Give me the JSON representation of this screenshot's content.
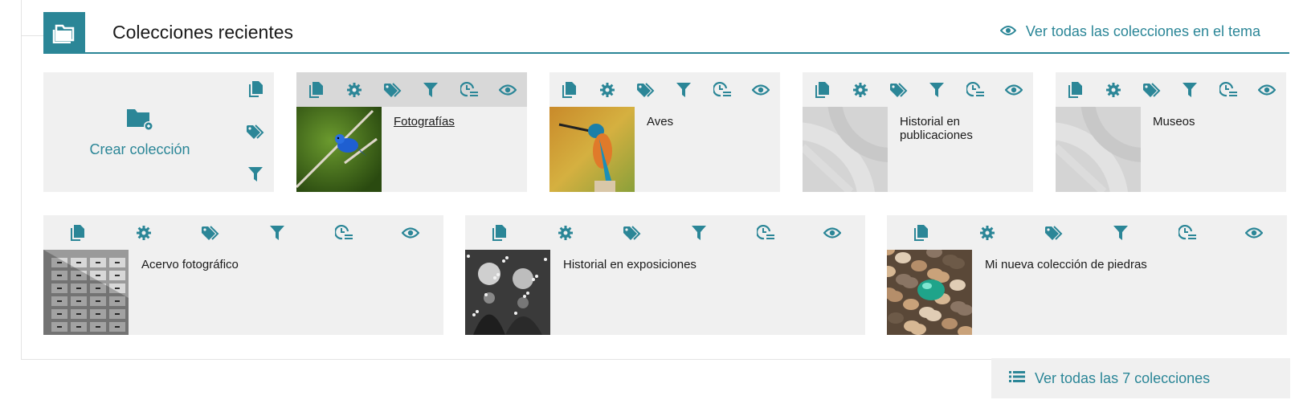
{
  "header": {
    "title": "Colecciones recientes",
    "icon": "folder-open-icon",
    "view_all_label": "Ver todas las colecciones en el tema",
    "view_all_icon": "eye-icon"
  },
  "create": {
    "label": "Crear colección",
    "icon": "folder-plus-icon",
    "side_icons": [
      "copy-icon",
      "tag-icon",
      "filter-icon"
    ]
  },
  "toolbar_icons": [
    "copy-icon",
    "gear-icon",
    "tag-icon",
    "filter-icon",
    "clock-list-icon",
    "eye-icon"
  ],
  "row1": [
    {
      "title": "Fotografías",
      "thumb": "blue-bird",
      "active": true
    },
    {
      "title": "Aves",
      "thumb": "kingfisher",
      "active": false
    },
    {
      "title": "Historial en publicaciones",
      "thumb": "placeholder",
      "active": false
    },
    {
      "title": "Museos",
      "thumb": "placeholder",
      "active": false
    }
  ],
  "row2": [
    {
      "title": "Acervo fotográfico",
      "thumb": "cabinet-bw"
    },
    {
      "title": "Historial en exposiciones",
      "thumb": "people-bw"
    },
    {
      "title": "Mi nueva colección de piedras",
      "thumb": "pebbles"
    }
  ],
  "footer": {
    "label": "Ver todas las 7 colecciones",
    "icon": "list-icon"
  },
  "colors": {
    "accent": "#2b8697",
    "card_bg": "#f0f0f0",
    "toolbar_active_bg": "#d8d8d8"
  }
}
